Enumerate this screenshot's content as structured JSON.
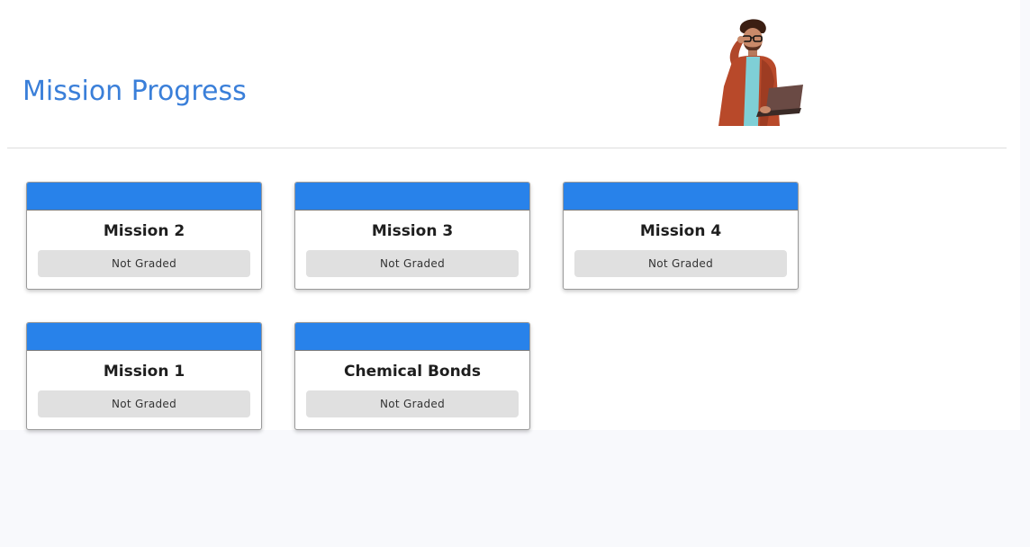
{
  "header": {
    "title": "Mission Progress"
  },
  "missions": [
    {
      "title": "Mission 2",
      "status": "Not Graded"
    },
    {
      "title": "Mission 3",
      "status": "Not Graded"
    },
    {
      "title": "Mission 4",
      "status": "Not Graded"
    },
    {
      "title": "Mission 1",
      "status": "Not Graded"
    },
    {
      "title": "Chemical Bonds",
      "status": "Not Graded"
    }
  ],
  "colors": {
    "accent": "#2882ea",
    "title": "#3a7fd9",
    "badge_bg": "#e0e0e0"
  }
}
